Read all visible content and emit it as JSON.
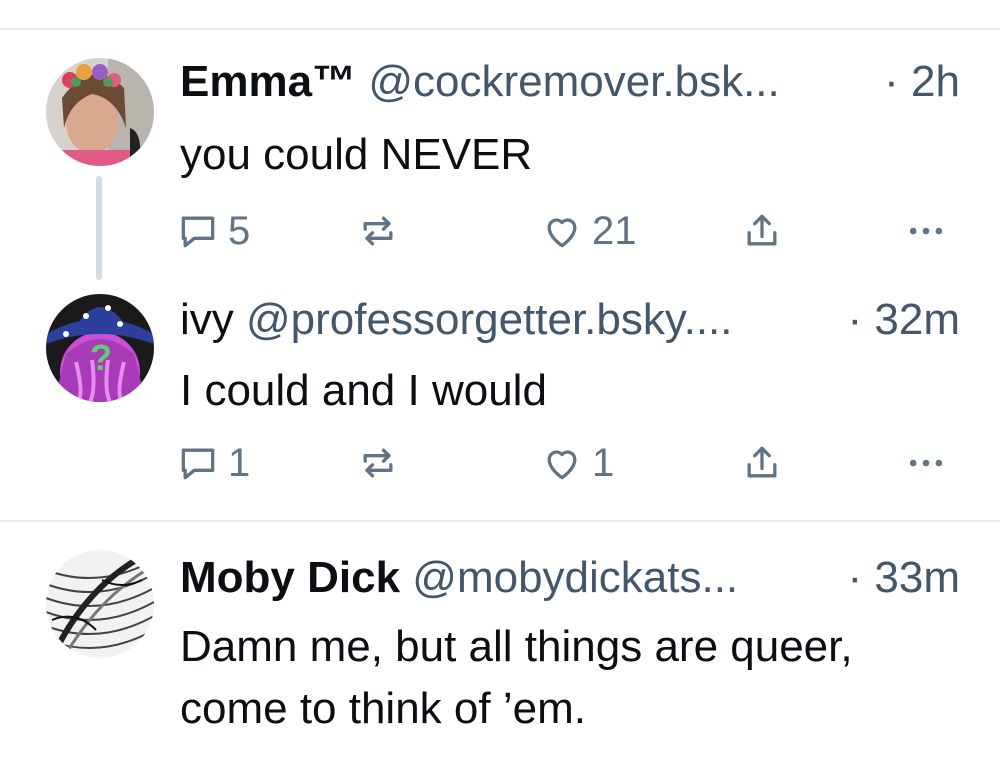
{
  "posts": [
    {
      "name": "Emma™",
      "handle": "@cockremover.bsk...",
      "separator": "·",
      "time": "2h",
      "text": "you could NEVER",
      "replies": "5",
      "likes": "21"
    },
    {
      "name": "ivy",
      "handle": "@professorgetter.bsky....",
      "separator": "·",
      "time": "32m",
      "text": "I could and I would",
      "replies": "1",
      "likes": "1"
    },
    {
      "name": "Moby Dick",
      "handle": "@mobydickats...",
      "separator": "·",
      "time": "33m",
      "text": "Damn me, but all things are queer, come to think of ’em."
    }
  ],
  "icons": {
    "reply": "reply-icon",
    "repost": "repost-icon",
    "like": "heart-icon",
    "share": "share-icon",
    "more": "more-icon"
  },
  "colors": {
    "text": "#0b0f14",
    "muted": "#42576c",
    "icon": "#607486",
    "thread_line": "#d4dce6",
    "divider": "#e6e9ee"
  }
}
